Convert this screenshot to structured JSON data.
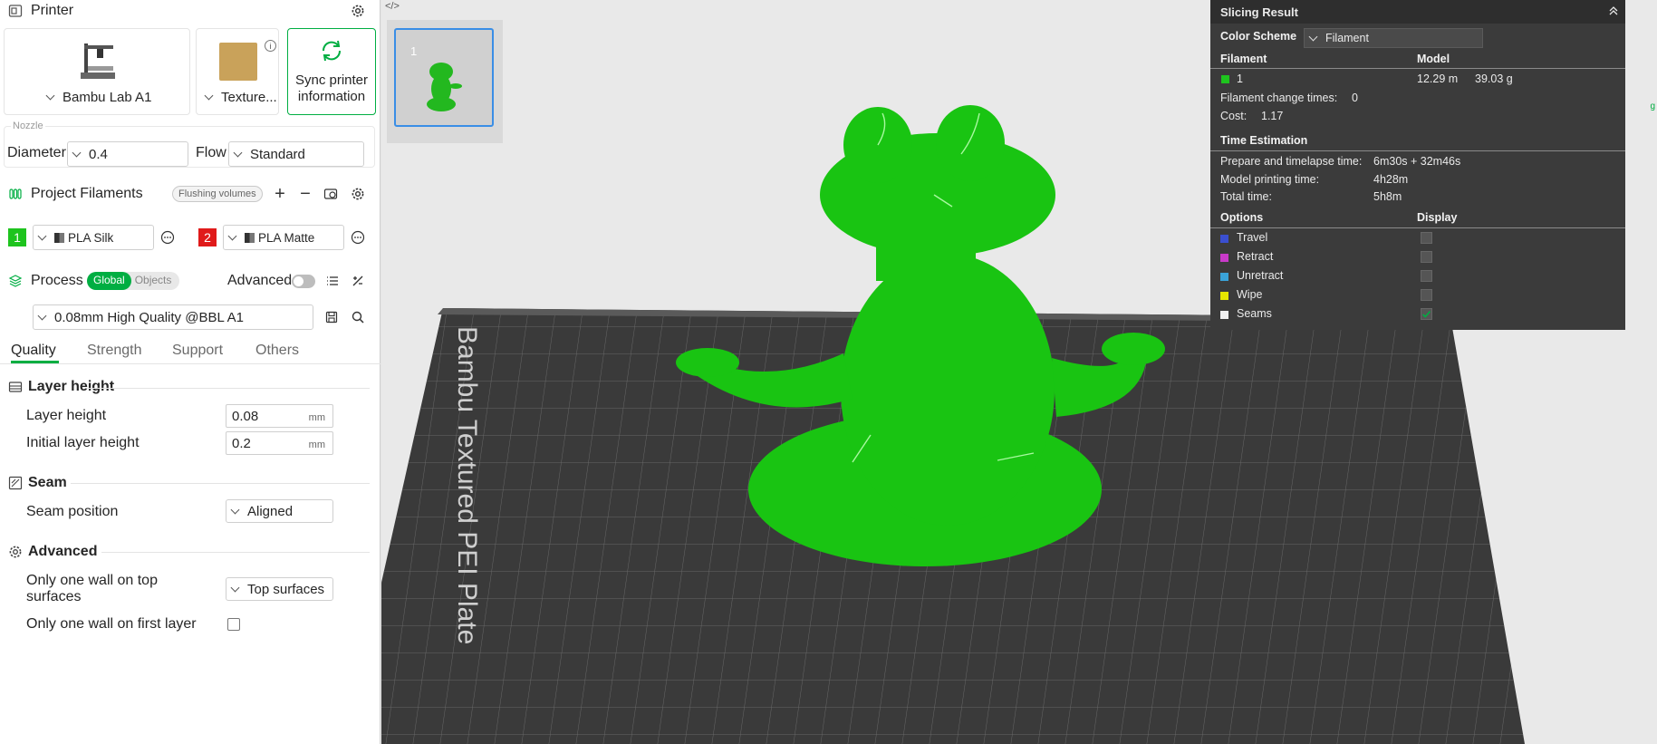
{
  "printer": {
    "title": "Printer",
    "printer_name": "Bambu Lab A1",
    "plate_name": "Texture...",
    "sync_label_1": "Sync printer",
    "sync_label_2": "information"
  },
  "nozzle": {
    "group_label": "Nozzle",
    "diameter_label": "Diameter",
    "diameter_value": "0.4",
    "flow_label": "Flow",
    "flow_value": "Standard"
  },
  "filaments": {
    "title": "Project Filaments",
    "flushing_label": "Flushing volumes",
    "items": [
      {
        "number": "1",
        "name": "PLA Silk",
        "color": "#1ec41e"
      },
      {
        "number": "2",
        "name": "PLA Matte",
        "color": "#e01a1a"
      }
    ]
  },
  "process": {
    "title": "Process",
    "global_label": "Global",
    "objects_label": "Objects",
    "advanced_label": "Advanced",
    "preset": "0.08mm High Quality @BBL A1",
    "tabs": [
      "Quality",
      "Strength",
      "Support",
      "Others"
    ],
    "active_tab": "Quality"
  },
  "quality": {
    "layer_height_group": "Layer height",
    "layer_height_label": "Layer height",
    "layer_height_value": "0.08",
    "initial_layer_height_label": "Initial layer height",
    "initial_layer_height_value": "0.2",
    "unit": "mm",
    "seam_group": "Seam",
    "seam_position_label": "Seam position",
    "seam_position_value": "Aligned",
    "advanced_group": "Advanced",
    "one_wall_top_label_1": "Only one wall on top",
    "one_wall_top_label_2": "surfaces",
    "one_wall_top_value": "Top surfaces",
    "one_wall_first_label": "Only one wall on first layer",
    "one_wall_first_checked": false
  },
  "viewport": {
    "plate_number": "1",
    "bed_text": "Bambu Textured PEI Plate"
  },
  "slicing": {
    "title": "Slicing Result",
    "color_scheme_label": "Color Scheme",
    "color_scheme_value": "Filament",
    "col_filament": "Filament",
    "col_model": "Model",
    "filament_id": "1",
    "filament_color": "#1ec41e",
    "filament_length": "12.29 m",
    "filament_weight": "39.03 g",
    "change_times_label": "Filament change times:",
    "change_times_value": "0",
    "cost_label": "Cost:",
    "cost_value": "1.17",
    "time_title": "Time Estimation",
    "prepare_label": "Prepare and timelapse time:",
    "prepare_value": "6m30s + 32m46s",
    "printing_label": "Model printing time:",
    "printing_value": "4h28m",
    "total_label": "Total time:",
    "total_value": "5h8m",
    "options_label": "Options",
    "display_label": "Display",
    "options": [
      {
        "name": "Travel",
        "color": "#3a4fd0",
        "checked": false
      },
      {
        "name": "Retract",
        "color": "#c93ac9",
        "checked": false
      },
      {
        "name": "Unretract",
        "color": "#3aa3d9",
        "checked": false
      },
      {
        "name": "Wipe",
        "color": "#e6e600",
        "checked": false
      },
      {
        "name": "Seams",
        "color": "#f0f0f0",
        "checked": true
      }
    ]
  },
  "colors": {
    "accent": "#00ae42",
    "model": "#1ec41e",
    "bed": "#3c3c3c"
  }
}
